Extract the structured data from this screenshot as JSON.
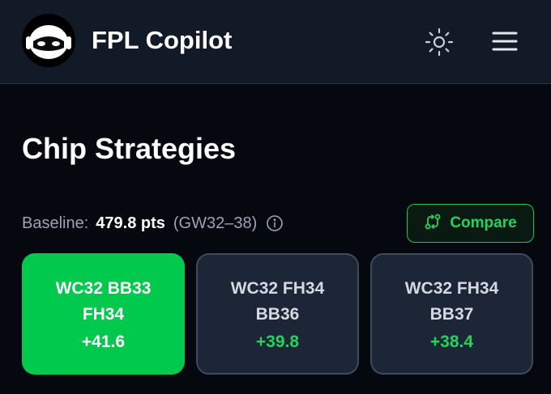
{
  "header": {
    "app_title": "FPL Copilot",
    "logo_icon": "robot-mascot-icon",
    "theme_icon": "sun-icon",
    "menu_icon": "hamburger-menu-icon"
  },
  "page": {
    "title": "Chip Strategies"
  },
  "baseline": {
    "label": "Baseline:",
    "value": "479.8 pts",
    "range": "(GW32–38)",
    "info_icon": "info-icon"
  },
  "compare": {
    "label": "Compare",
    "icon": "git-compare-icon"
  },
  "strategies": [
    {
      "name": "WC32 BB33 FH34",
      "delta": "+41.6",
      "selected": true
    },
    {
      "name": "WC32 FH34 BB36",
      "delta": "+39.8",
      "selected": false
    },
    {
      "name": "WC32 FH34 BB37",
      "delta": "+38.4",
      "selected": false
    }
  ],
  "colors": {
    "accent_green": "#00c94d",
    "positive_text": "#22d35c",
    "header_bg": "#121a27",
    "page_bg": "#05080f",
    "card_bg": "#1c2636"
  }
}
